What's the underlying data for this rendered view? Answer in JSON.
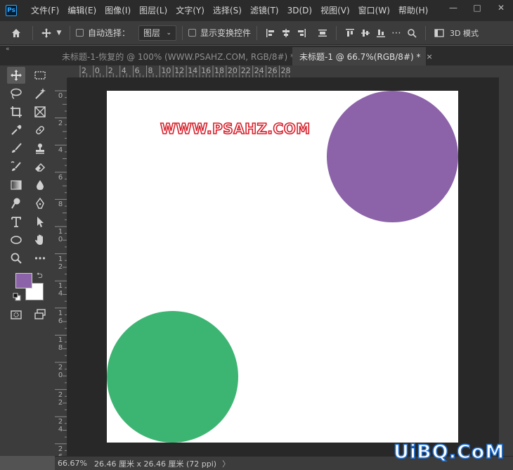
{
  "app": {
    "logo_text": "Ps",
    "menu": [
      "文件(F)",
      "编辑(E)",
      "图像(I)",
      "图层(L)",
      "文字(Y)",
      "选择(S)",
      "滤镜(T)",
      "3D(D)",
      "视图(V)",
      "窗口(W)",
      "帮助(H)"
    ],
    "window_controls": [
      "—",
      "□",
      "✕"
    ]
  },
  "options_bar": {
    "auto_select_label": "自动选择：",
    "auto_select_value": "图层",
    "show_transform_label": "显示变换控件",
    "mode_3d_label": "3D 模式"
  },
  "tabs": {
    "collapse": "«",
    "items": [
      {
        "label": "未标题-1-恢复的 @ 100% (WWW.PSAHZ.COM, RGB/8#) *",
        "active": false,
        "close": "×"
      },
      {
        "label": "未标题-1 @ 66.7%(RGB/8#) *",
        "active": true,
        "close": "×"
      }
    ]
  },
  "rulers": {
    "top": [
      "2",
      "0",
      "2",
      "4",
      "6",
      "8",
      "10",
      "12",
      "14",
      "16",
      "18",
      "20",
      "22",
      "24",
      "26",
      "28"
    ],
    "left": [
      "0",
      "2",
      "4",
      "6",
      "8",
      "10",
      "12",
      "14",
      "16",
      "18",
      "20",
      "22",
      "24",
      "26"
    ]
  },
  "colors": {
    "foreground": "#8c62a8",
    "background": "#ffffff",
    "purple_circle": "#8c62a8",
    "green_circle": "#3db572",
    "watermark_stroke": "#d81e2a"
  },
  "canvas": {
    "watermark_text": "WWW.PSAHZ.COM"
  },
  "status": {
    "zoom": "66.67%",
    "doc_size": "26.46 厘米 x 26.46 厘米 (72 ppi)",
    "arrow": "〉"
  },
  "site_logo": "UiBQ.CoM"
}
